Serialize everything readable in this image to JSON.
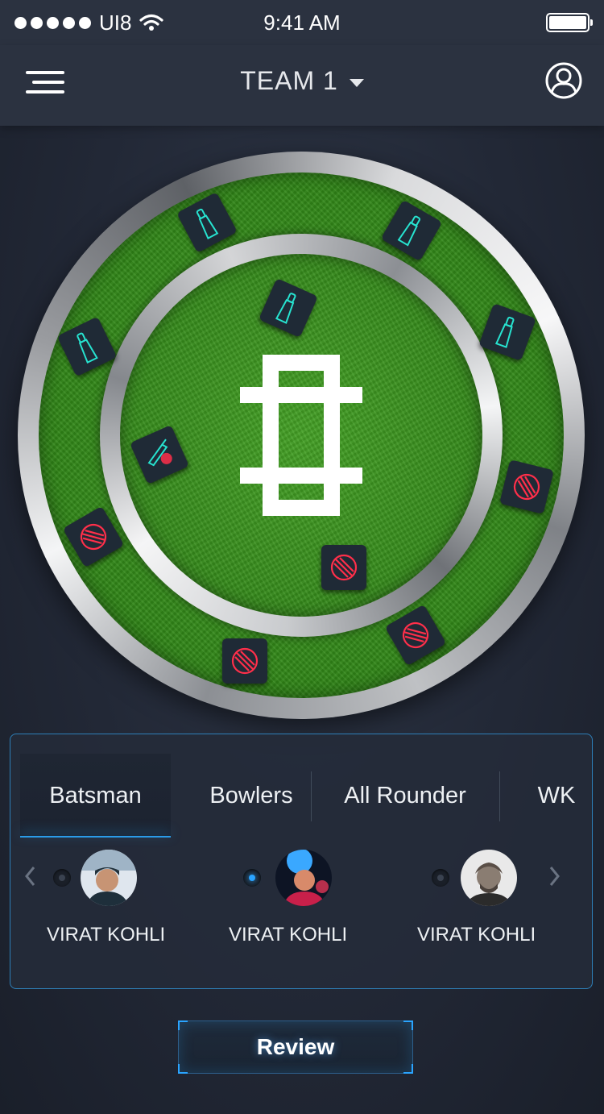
{
  "status_bar": {
    "carrier": "UI8",
    "time": "9:41 AM"
  },
  "header": {
    "team_name": "TEAM 1",
    "menu_icon": "hamburger-menu-icon",
    "profile_icon": "user-profile-icon"
  },
  "field": {
    "pitch_icon": "cricket-pitch-icon",
    "batsman_icon": "cricket-bat-icon",
    "bowler_icon": "cricket-ball-icon",
    "allrounder_icon": "bat-and-ball-icon",
    "bat_color": "#27e3d0",
    "ball_color": "#ff2f4a"
  },
  "tabs": [
    {
      "label": "Batsman",
      "active": true
    },
    {
      "label": "Bowlers",
      "active": false
    },
    {
      "label": "All Rounder",
      "active": false
    },
    {
      "label": "WK",
      "active": false
    }
  ],
  "players": [
    {
      "name": "VIRAT KOHLI",
      "selected": false
    },
    {
      "name": "VIRAT KOHLI",
      "selected": true
    },
    {
      "name": "VIRAT KOHLI",
      "selected": false
    }
  ],
  "review_label": "Review",
  "colors": {
    "accent": "#2a9be8",
    "background": "#222836",
    "bar": "#2b3240"
  }
}
